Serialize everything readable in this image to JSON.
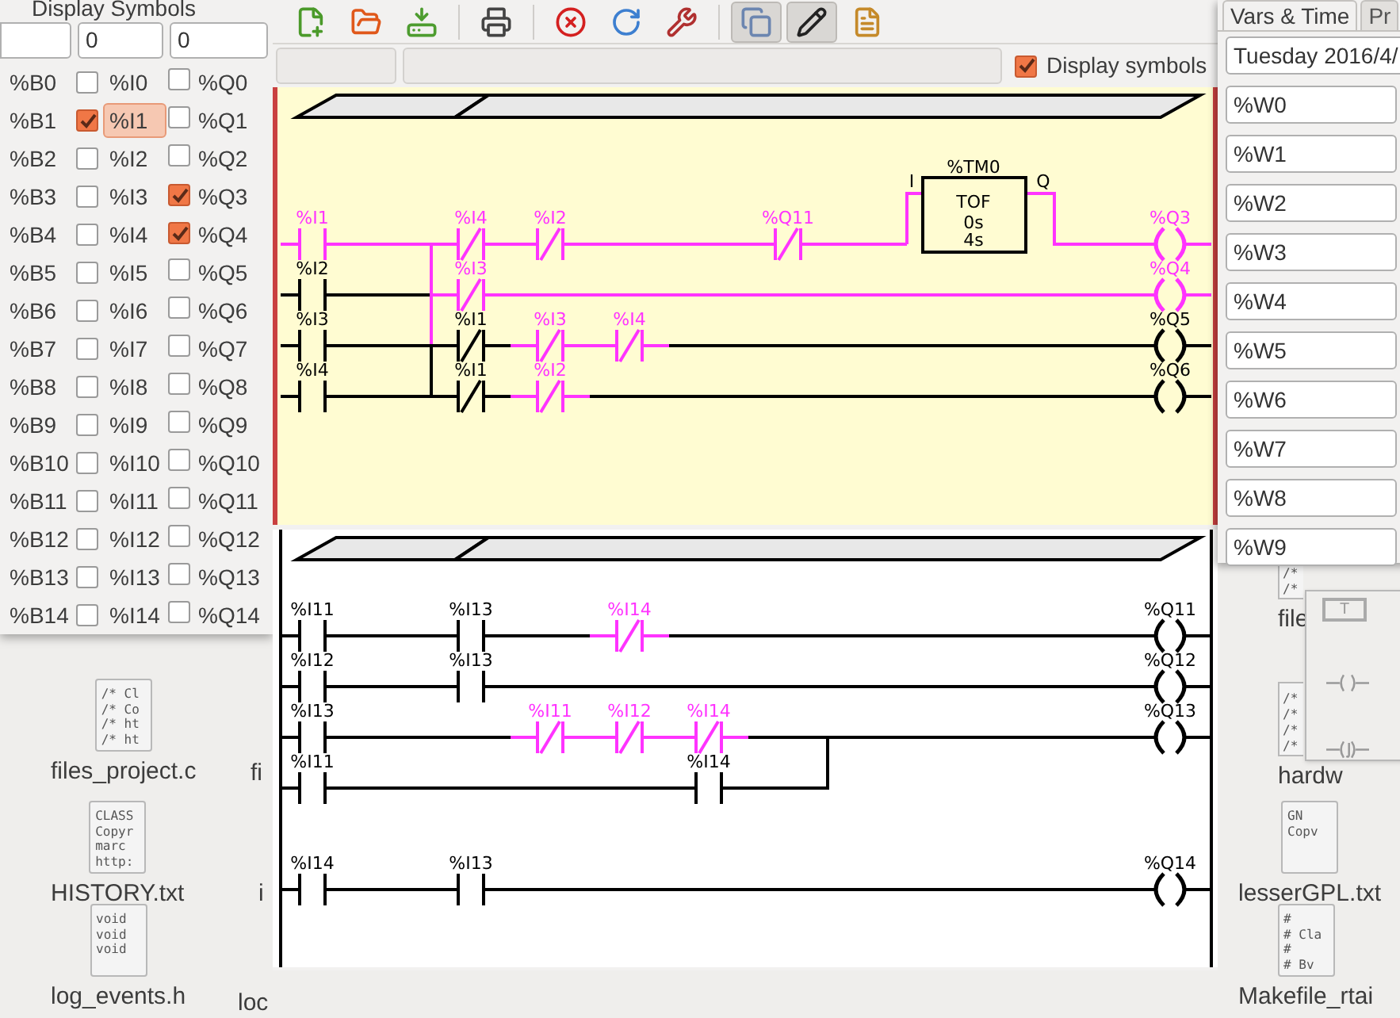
{
  "symbols_window": {
    "title": "Display Symbols",
    "fields": [
      "0",
      "0"
    ],
    "rows": [
      {
        "bit": "%B0",
        "input": "%I0",
        "input_checked": false,
        "input_highlighted": false,
        "output": "%Q0",
        "output_checked": false
      },
      {
        "bit": "%B1",
        "input": "%I1",
        "input_checked": true,
        "input_highlighted": true,
        "output": "%Q1",
        "output_checked": false
      },
      {
        "bit": "%B2",
        "input": "%I2",
        "input_checked": false,
        "input_highlighted": false,
        "output": "%Q2",
        "output_checked": false
      },
      {
        "bit": "%B3",
        "input": "%I3",
        "input_checked": false,
        "input_highlighted": false,
        "output": "%Q3",
        "output_checked": true
      },
      {
        "bit": "%B4",
        "input": "%I4",
        "input_checked": false,
        "input_highlighted": false,
        "output": "%Q4",
        "output_checked": true
      },
      {
        "bit": "%B5",
        "input": "%I5",
        "input_checked": false,
        "input_highlighted": false,
        "output": "%Q5",
        "output_checked": false
      },
      {
        "bit": "%B6",
        "input": "%I6",
        "input_checked": false,
        "input_highlighted": false,
        "output": "%Q6",
        "output_checked": false
      },
      {
        "bit": "%B7",
        "input": "%I7",
        "input_checked": false,
        "input_highlighted": false,
        "output": "%Q7",
        "output_checked": false
      },
      {
        "bit": "%B8",
        "input": "%I8",
        "input_checked": false,
        "input_highlighted": false,
        "output": "%Q8",
        "output_checked": false
      },
      {
        "bit": "%B9",
        "input": "%I9",
        "input_checked": false,
        "input_highlighted": false,
        "output": "%Q9",
        "output_checked": false
      },
      {
        "bit": "%B10",
        "input": "%I10",
        "input_checked": false,
        "input_highlighted": false,
        "output": "%Q10",
        "output_checked": false
      },
      {
        "bit": "%B11",
        "input": "%I11",
        "input_checked": false,
        "input_highlighted": false,
        "output": "%Q11",
        "output_checked": false
      },
      {
        "bit": "%B12",
        "input": "%I12",
        "input_checked": false,
        "input_highlighted": false,
        "output": "%Q12",
        "output_checked": false
      },
      {
        "bit": "%B13",
        "input": "%I13",
        "input_checked": false,
        "input_highlighted": false,
        "output": "%Q13",
        "output_checked": false
      },
      {
        "bit": "%B14",
        "input": "%I14",
        "input_checked": false,
        "input_highlighted": false,
        "output": "%Q14",
        "output_checked": false
      }
    ]
  },
  "toolbar": {
    "groups": [
      [
        {
          "kind": "new",
          "pressed": false
        },
        {
          "kind": "open",
          "pressed": false
        },
        {
          "kind": "save",
          "pressed": false
        }
      ],
      [
        {
          "kind": "print",
          "pressed": false
        }
      ],
      [
        {
          "kind": "stop",
          "pressed": false
        },
        {
          "kind": "reset",
          "pressed": false
        },
        {
          "kind": "config",
          "pressed": false
        }
      ],
      [
        {
          "kind": "sections",
          "pressed": true
        },
        {
          "kind": "edit",
          "pressed": true
        },
        {
          "kind": "symbols",
          "pressed": false
        }
      ]
    ]
  },
  "display_symbols": {
    "label": "Display symbols",
    "checked": true
  },
  "ladder": {
    "sections": [
      {
        "selected": true,
        "rows": [
          {
            "cells": [
              {
                "kind": "none"
              },
              {
                "kind": "none"
              },
              {
                "kind": "none"
              },
              {
                "kind": "none"
              },
              {
                "kind": "none"
              },
              {
                "kind": "none"
              },
              {
                "kind": "none"
              },
              {
                "kind": "none"
              },
              {
                "kind": "none"
              },
              {
                "kind": "none"
              },
              {
                "kind": "none"
              },
              {
                "kind": "none"
              }
            ]
          },
          {
            "cells": [
              {
                "kind": "contact_no",
                "label": "%I1",
                "on": true,
                "link_down": false
              },
              {
                "kind": "wire",
                "on": true,
                "link_down": false
              },
              {
                "kind": "contact_nc",
                "label": "%I4",
                "on": true,
                "link_down": true
              },
              {
                "kind": "contact_nc",
                "label": "%I2",
                "on": true,
                "link_down": false
              },
              {
                "kind": "wire",
                "on": true,
                "link_down": false
              },
              {
                "kind": "wire",
                "on": true,
                "link_down": false
              },
              {
                "kind": "contact_nc",
                "label": "%Q11",
                "on": true,
                "link_down": false
              },
              {
                "kind": "wire",
                "on": true,
                "link_down": false
              },
              {
                "kind": "timer",
                "label": "%TM0",
                "type": "TOF",
                "presets": [
                  "0s",
                  "4s"
                ],
                "input_label": "I",
                "output_label": "Q",
                "on": true,
                "output_on": true,
                "link_down": false
              },
              {
                "kind": "none"
              },
              {
                "kind": "wire",
                "on": true,
                "link_down": false
              },
              {
                "kind": "coil",
                "label": "%Q3",
                "on": true,
                "link_down": false
              }
            ]
          },
          {
            "cells": [
              {
                "kind": "contact_no",
                "label": "%I2",
                "on": false,
                "link_down": false
              },
              {
                "kind": "wire",
                "on": false,
                "link_down": false
              },
              {
                "kind": "contact_nc",
                "label": "%I3",
                "on": true,
                "link_down": true
              },
              {
                "kind": "wire",
                "on": true,
                "link_down": false
              },
              {
                "kind": "wire",
                "on": true,
                "link_down": false
              },
              {
                "kind": "wire",
                "on": true,
                "link_down": false
              },
              {
                "kind": "wire",
                "on": true,
                "link_down": false
              },
              {
                "kind": "wire",
                "on": true,
                "link_down": false
              },
              {
                "kind": "wire",
                "on": true,
                "link_down": false
              },
              {
                "kind": "wire",
                "on": true,
                "link_down": false
              },
              {
                "kind": "wire",
                "on": true,
                "link_down": false
              },
              {
                "kind": "coil",
                "label": "%Q4",
                "on": true,
                "link_down": false
              }
            ]
          },
          {
            "cells": [
              {
                "kind": "contact_no",
                "label": "%I3",
                "on": false,
                "link_down": false
              },
              {
                "kind": "wire",
                "on": false,
                "link_down": false
              },
              {
                "kind": "contact_nc",
                "label": "%I1",
                "on": false,
                "link_down": true
              },
              {
                "kind": "contact_nc",
                "label": "%I3",
                "on": true,
                "link_down": false
              },
              {
                "kind": "contact_nc",
                "label": "%I4",
                "on": true,
                "link_down": false
              },
              {
                "kind": "wire",
                "on": false,
                "link_down": false
              },
              {
                "kind": "wire",
                "on": false,
                "link_down": false
              },
              {
                "kind": "wire",
                "on": false,
                "link_down": false
              },
              {
                "kind": "wire",
                "on": false,
                "link_down": false
              },
              {
                "kind": "wire",
                "on": false,
                "link_down": false
              },
              {
                "kind": "wire",
                "on": false,
                "link_down": false
              },
              {
                "kind": "coil",
                "label": "%Q5",
                "on": false,
                "link_down": false
              }
            ]
          },
          {
            "cells": [
              {
                "kind": "contact_no",
                "label": "%I4",
                "on": false,
                "link_down": false
              },
              {
                "kind": "wire",
                "on": false,
                "link_down": false
              },
              {
                "kind": "contact_nc",
                "label": "%I1",
                "on": false,
                "link_down": false
              },
              {
                "kind": "contact_nc",
                "label": "%I2",
                "on": true,
                "link_down": false
              },
              {
                "kind": "wire",
                "on": false,
                "link_down": false
              },
              {
                "kind": "wire",
                "on": false,
                "link_down": false
              },
              {
                "kind": "wire",
                "on": false,
                "link_down": false
              },
              {
                "kind": "wire",
                "on": false,
                "link_down": false
              },
              {
                "kind": "wire",
                "on": false,
                "link_down": false
              },
              {
                "kind": "wire",
                "on": false,
                "link_down": false
              },
              {
                "kind": "wire",
                "on": false,
                "link_down": false
              },
              {
                "kind": "coil",
                "label": "%Q6",
                "on": false,
                "link_down": false
              }
            ]
          }
        ]
      },
      {
        "selected": false,
        "rows": [
          {
            "cells": [
              {
                "kind": "contact_no",
                "label": "%I11",
                "on": false,
                "link_down": false
              },
              {
                "kind": "wire",
                "on": false,
                "link_down": false
              },
              {
                "kind": "contact_no",
                "label": "%I13",
                "on": false,
                "link_down": false
              },
              {
                "kind": "wire",
                "on": false,
                "link_down": false
              },
              {
                "kind": "contact_nc",
                "label": "%I14",
                "on": true,
                "link_down": false
              },
              {
                "kind": "wire",
                "on": false,
                "link_down": false
              },
              {
                "kind": "wire",
                "on": false,
                "link_down": false
              },
              {
                "kind": "wire",
                "on": false,
                "link_down": false
              },
              {
                "kind": "wire",
                "on": false,
                "link_down": false
              },
              {
                "kind": "wire",
                "on": false,
                "link_down": false
              },
              {
                "kind": "wire",
                "on": false,
                "link_down": false
              },
              {
                "kind": "coil",
                "label": "%Q11",
                "on": false,
                "link_down": false
              }
            ]
          },
          {
            "cells": [
              {
                "kind": "contact_no",
                "label": "%I12",
                "on": false,
                "link_down": false
              },
              {
                "kind": "wire",
                "on": false,
                "link_down": false
              },
              {
                "kind": "contact_no",
                "label": "%I13",
                "on": false,
                "link_down": false
              },
              {
                "kind": "wire",
                "on": false,
                "link_down": false
              },
              {
                "kind": "wire",
                "on": false,
                "link_down": false
              },
              {
                "kind": "wire",
                "on": false,
                "link_down": false
              },
              {
                "kind": "wire",
                "on": false,
                "link_down": false
              },
              {
                "kind": "wire",
                "on": false,
                "link_down": false
              },
              {
                "kind": "wire",
                "on": false,
                "link_down": false
              },
              {
                "kind": "wire",
                "on": false,
                "link_down": false
              },
              {
                "kind": "wire",
                "on": false,
                "link_down": false
              },
              {
                "kind": "coil",
                "label": "%Q12",
                "on": false,
                "link_down": false
              }
            ]
          },
          {
            "cells": [
              {
                "kind": "contact_no",
                "label": "%I13",
                "on": false,
                "link_down": false
              },
              {
                "kind": "wire",
                "on": false,
                "link_down": false
              },
              {
                "kind": "wire",
                "on": false,
                "link_down": false
              },
              {
                "kind": "contact_nc",
                "label": "%I11",
                "on": true,
                "link_down": false
              },
              {
                "kind": "contact_nc",
                "label": "%I12",
                "on": true,
                "link_down": false
              },
              {
                "kind": "contact_nc",
                "label": "%I14",
                "on": true,
                "link_down": false
              },
              {
                "kind": "wire",
                "on": false,
                "link_down": false
              },
              {
                "kind": "wire",
                "on": false,
                "link_down": true
              },
              {
                "kind": "wire",
                "on": false,
                "link_down": false
              },
              {
                "kind": "wire",
                "on": false,
                "link_down": false
              },
              {
                "kind": "wire",
                "on": false,
                "link_down": false
              },
              {
                "kind": "coil",
                "label": "%Q13",
                "on": false,
                "link_down": false
              }
            ]
          },
          {
            "cells": [
              {
                "kind": "contact_no",
                "label": "%I11",
                "on": false,
                "link_down": false
              },
              {
                "kind": "wire",
                "on": false,
                "link_down": false
              },
              {
                "kind": "wire",
                "on": false,
                "link_down": false
              },
              {
                "kind": "wire",
                "on": false,
                "link_down": false
              },
              {
                "kind": "wire",
                "on": false,
                "link_down": false
              },
              {
                "kind": "contact_no",
                "label": "%I14",
                "on": false,
                "link_down": false
              },
              {
                "kind": "wire",
                "on": false,
                "link_down": false
              },
              {
                "kind": "none"
              },
              {
                "kind": "none"
              },
              {
                "kind": "none"
              },
              {
                "kind": "none"
              },
              {
                "kind": "none"
              }
            ]
          },
          {
            "cells": [
              {
                "kind": "none"
              },
              {
                "kind": "none"
              },
              {
                "kind": "none"
              },
              {
                "kind": "none"
              },
              {
                "kind": "none"
              },
              {
                "kind": "none"
              },
              {
                "kind": "none"
              },
              {
                "kind": "none"
              },
              {
                "kind": "none"
              },
              {
                "kind": "none"
              },
              {
                "kind": "none"
              },
              {
                "kind": "none"
              }
            ]
          },
          {
            "cells": [
              {
                "kind": "contact_no",
                "label": "%I14",
                "on": false,
                "link_down": false
              },
              {
                "kind": "wire",
                "on": false,
                "link_down": false
              },
              {
                "kind": "contact_no",
                "label": "%I13",
                "on": false,
                "link_down": false
              },
              {
                "kind": "wire",
                "on": false,
                "link_down": false
              },
              {
                "kind": "wire",
                "on": false,
                "link_down": false
              },
              {
                "kind": "wire",
                "on": false,
                "link_down": false
              },
              {
                "kind": "wire",
                "on": false,
                "link_down": false
              },
              {
                "kind": "wire",
                "on": false,
                "link_down": false
              },
              {
                "kind": "wire",
                "on": false,
                "link_down": false
              },
              {
                "kind": "wire",
                "on": false,
                "link_down": false
              },
              {
                "kind": "wire",
                "on": false,
                "link_down": false
              },
              {
                "kind": "coil",
                "label": "%Q14",
                "on": false,
                "link_down": false
              }
            ]
          }
        ]
      }
    ]
  },
  "vars_window": {
    "tabs": [
      {
        "label": "Vars & Time",
        "selected": true
      },
      {
        "label": "Pr",
        "selected": false
      }
    ],
    "date": "Tuesday 2016/4/",
    "words": [
      "%W0",
      "%W1",
      "%W2",
      "%W3",
      "%W4",
      "%W5",
      "%W6",
      "%W7",
      "%W8",
      "%W9"
    ]
  },
  "toolbox": [
    {
      "kind": "timer",
      "label": "T"
    },
    {
      "kind": "coil"
    },
    {
      "kind": "negated_coil"
    }
  ],
  "desktop_files": [
    {
      "name": "files_project.c",
      "preview": [
        "/* Cl",
        "/* Co",
        "/* ht",
        "/* ht"
      ]
    },
    {
      "name": "HISTORY.txt",
      "preview": [
        "CLASS",
        "Copyr",
        "marc",
        "http:"
      ]
    },
    {
      "name": "log_events.h",
      "preview": [
        "void",
        "void",
        "void"
      ]
    },
    {
      "name": "fi"
    },
    {
      "name": "i"
    },
    {
      "name": "loc"
    },
    {
      "name": "file",
      "preview": [
        "/*",
        "/*"
      ]
    },
    {
      "name": "hardw",
      "preview": [
        "/*",
        "/*",
        "/*",
        "/*"
      ]
    },
    {
      "name": "lesserGPL.txt",
      "preview": [
        "GN",
        "Copv"
      ]
    },
    {
      "name": "Makefile_rtai",
      "preview": [
        "#",
        "# Cla",
        "#",
        "# Bv"
      ]
    }
  ]
}
